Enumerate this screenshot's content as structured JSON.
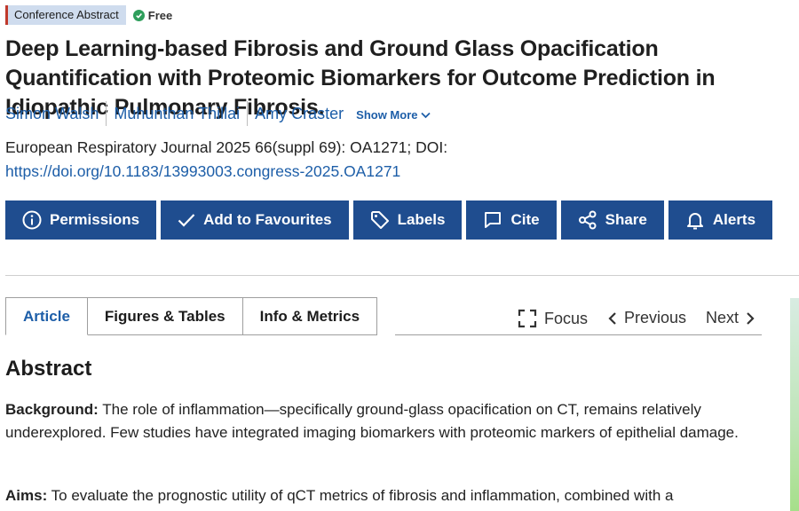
{
  "badges": {
    "type": "Conference Abstract",
    "free": "Free"
  },
  "title": "Deep Learning-based Fibrosis and Ground Glass Opacification Quantification with Proteomic Biomarkers for Outcome Prediction in Idiopathic Pulmonary Fibrosis.",
  "authors": [
    "Simon Walsh",
    "Muhunthan Thillai",
    "Amy Craster"
  ],
  "show_more": "Show More",
  "citation": {
    "journal_line": "European Respiratory Journal 2025 66(suppl 69): OA1271; DOI:",
    "doi": "https://doi.org/10.1183/13993003.congress-2025.OA1271"
  },
  "actions": {
    "permissions": "Permissions",
    "favourites": "Add to Favourites",
    "labels": "Labels",
    "cite": "Cite",
    "share": "Share",
    "alerts": "Alerts"
  },
  "tabs": {
    "article": "Article",
    "figures": "Figures & Tables",
    "info": "Info & Metrics"
  },
  "nav": {
    "focus": "Focus",
    "previous": "Previous",
    "next": "Next"
  },
  "abstract": {
    "heading": "Abstract",
    "background_label": "Background:",
    "background_text": "The role of inflammation—specifically ground-glass opacification on CT, remains relatively underexplored. Few studies have integrated imaging biomarkers with proteomic markers of epithelial damage.",
    "aims_label": "Aims:",
    "aims_text": "To evaluate the prognostic utility of qCT metrics of fibrosis and inflammation, combined with a"
  },
  "colors": {
    "primary_button": "#1f4d8f",
    "link": "#1d5ea8",
    "badge_bg": "#cfdcee",
    "free_green": "#2e9e5b"
  },
  "icons": [
    "check-circle-icon",
    "chevron-down-icon",
    "info-icon",
    "check-icon",
    "tag-icon",
    "speech-bubble-icon",
    "share-icon",
    "bell-icon",
    "focus-brackets-icon",
    "chevron-left-icon",
    "chevron-right-icon"
  ]
}
